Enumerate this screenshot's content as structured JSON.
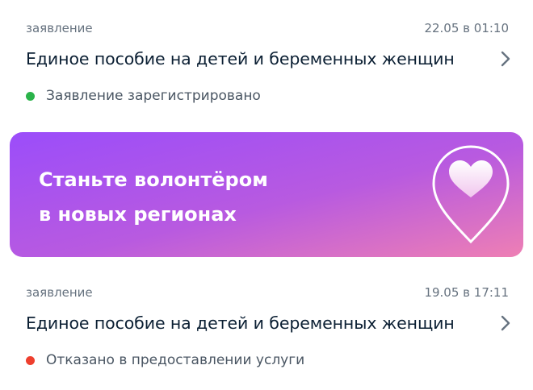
{
  "colors": {
    "text_primary": "#0b1f33",
    "text_secondary": "#66727f",
    "status_success": "#2bb34a",
    "status_error": "#ee3f2e",
    "banner_gradient_start": "#9b4dfa",
    "banner_gradient_end": "#ee7fb4"
  },
  "applications": [
    {
      "type": "заявление",
      "datetime": "22.05 в 01:10",
      "title": "Единое пособие на детей и беременных женщин",
      "status": "Заявление зарегистрировано",
      "status_kind": "success",
      "icon": "chevron-right-icon"
    },
    {
      "type": "заявление",
      "datetime": "19.05 в 17:11",
      "title": "Единое пособие на детей и беременных женщин",
      "status": "Отказано в предоставлении услуги",
      "status_kind": "error",
      "icon": "chevron-right-icon"
    }
  ],
  "banner": {
    "line1": "Станьте волонтёром",
    "line2": "в новых регионах",
    "icon": "heart-location-pin-icon"
  }
}
